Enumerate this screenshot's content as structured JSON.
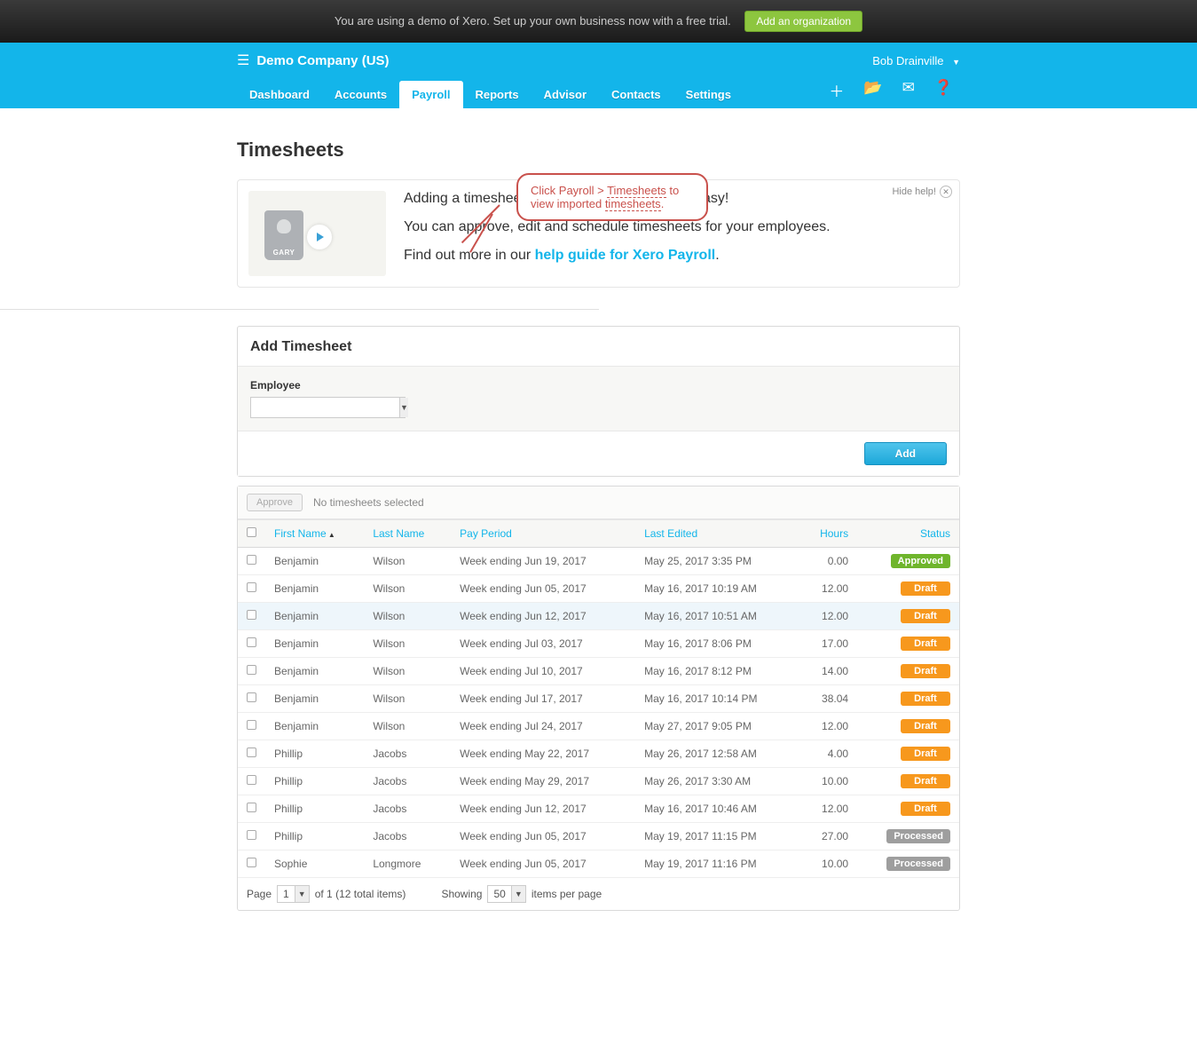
{
  "banner": {
    "text": "You are using a demo of Xero. Set up your own business now with a free trial.",
    "button": "Add an organization"
  },
  "org": {
    "name": "Demo Company (US)"
  },
  "user": {
    "name": "Bob Drainville"
  },
  "nav": {
    "dashboard": "Dashboard",
    "accounts": "Accounts",
    "payroll": "Payroll",
    "reports": "Reports",
    "advisor": "Advisor",
    "contacts": "Contacts",
    "settings": "Settings"
  },
  "page": {
    "title": "Timesheets"
  },
  "help": {
    "line1": "Adding a timesheet                                             asy!",
    "line2": "You can approve, edit and schedule timesheets for your employees.",
    "line3_prefix": "Find out more in our ",
    "line3_link": "help guide for Xero Payroll",
    "line3_suffix": ".",
    "hide": "Hide help!",
    "badge": "GARY"
  },
  "callout": {
    "p1": "Click Payroll > ",
    "u1": "Timesheets",
    "p2": " to view imported ",
    "u2": "timesheets",
    "p3": "."
  },
  "addCard": {
    "title": "Add Timesheet",
    "employeeLabel": "Employee",
    "addButton": "Add"
  },
  "list": {
    "approve": "Approve",
    "selText": "No timesheets selected",
    "headers": {
      "first": "First Name",
      "last": "Last Name",
      "period": "Pay Period",
      "edited": "Last Edited",
      "hours": "Hours",
      "status": "Status"
    },
    "rows": [
      {
        "first": "Benjamin",
        "last": "Wilson",
        "period": "Week ending Jun 19, 2017",
        "edited": "May 25, 2017 3:35 PM",
        "hours": "0.00",
        "status": "Approved"
      },
      {
        "first": "Benjamin",
        "last": "Wilson",
        "period": "Week ending Jun 05, 2017",
        "edited": "May 16, 2017 10:19 AM",
        "hours": "12.00",
        "status": "Draft"
      },
      {
        "first": "Benjamin",
        "last": "Wilson",
        "period": "Week ending Jun 12, 2017",
        "edited": "May 16, 2017 10:51 AM",
        "hours": "12.00",
        "status": "Draft",
        "hl": true
      },
      {
        "first": "Benjamin",
        "last": "Wilson",
        "period": "Week ending Jul 03, 2017",
        "edited": "May 16, 2017 8:06 PM",
        "hours": "17.00",
        "status": "Draft"
      },
      {
        "first": "Benjamin",
        "last": "Wilson",
        "period": "Week ending Jul 10, 2017",
        "edited": "May 16, 2017 8:12 PM",
        "hours": "14.00",
        "status": "Draft"
      },
      {
        "first": "Benjamin",
        "last": "Wilson",
        "period": "Week ending Jul 17, 2017",
        "edited": "May 16, 2017 10:14 PM",
        "hours": "38.04",
        "status": "Draft"
      },
      {
        "first": "Benjamin",
        "last": "Wilson",
        "period": "Week ending Jul 24, 2017",
        "edited": "May 27, 2017 9:05 PM",
        "hours": "12.00",
        "status": "Draft"
      },
      {
        "first": "Phillip",
        "last": "Jacobs",
        "period": "Week ending May 22, 2017",
        "edited": "May 26, 2017 12:58 AM",
        "hours": "4.00",
        "status": "Draft"
      },
      {
        "first": "Phillip",
        "last": "Jacobs",
        "period": "Week ending May 29, 2017",
        "edited": "May 26, 2017 3:30 AM",
        "hours": "10.00",
        "status": "Draft"
      },
      {
        "first": "Phillip",
        "last": "Jacobs",
        "period": "Week ending Jun 12, 2017",
        "edited": "May 16, 2017 10:46 AM",
        "hours": "12.00",
        "status": "Draft"
      },
      {
        "first": "Phillip",
        "last": "Jacobs",
        "period": "Week ending Jun 05, 2017",
        "edited": "May 19, 2017 11:15 PM",
        "hours": "27.00",
        "status": "Processed"
      },
      {
        "first": "Sophie",
        "last": "Longmore",
        "period": "Week ending Jun 05, 2017",
        "edited": "May 19, 2017 11:16 PM",
        "hours": "10.00",
        "status": "Processed"
      }
    ]
  },
  "pager": {
    "page_label": "Page",
    "page_val": "1",
    "of_text": "of 1 (12 total items)",
    "showing": "Showing",
    "per_val": "50",
    "per_text": "items per page"
  }
}
